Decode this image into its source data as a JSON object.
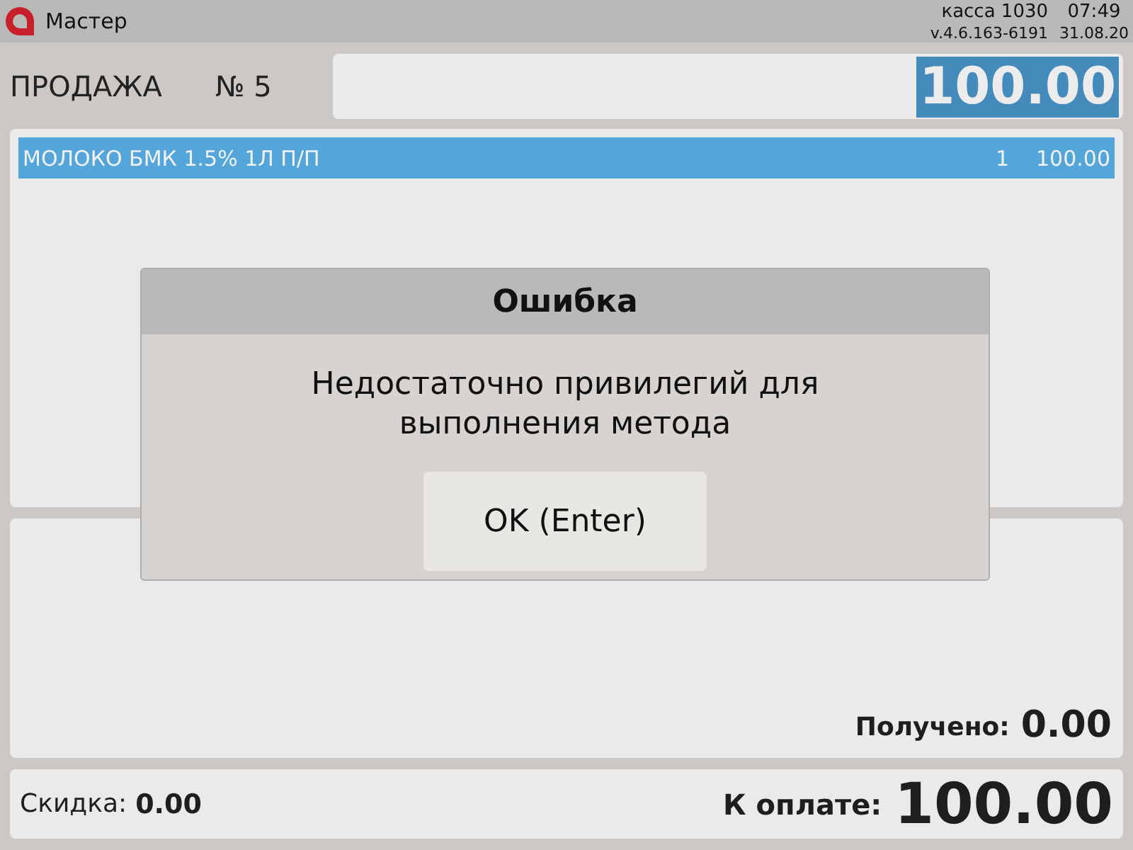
{
  "top_bar": {
    "app_name": "Мастер",
    "register": "касса 1030",
    "time": "07:49",
    "version": "v.4.6.163-6191",
    "date": "31.08.20"
  },
  "header": {
    "title": "ПРОДАЖА",
    "number": "№ 5",
    "total_field": {
      "value": "100.00",
      "highlighted": true
    }
  },
  "receipt": {
    "rows": [
      {
        "name": "МОЛОКО БМК 1.5% 1Л П/П",
        "quantity": "1",
        "amount": "100.00",
        "selected": true
      }
    ]
  },
  "payment": {
    "received_label": "Получено:",
    "received_value": "0.00"
  },
  "footer": {
    "discount_label": "Скидка:",
    "discount_value": "0.00",
    "due_label": "К оплате:",
    "due_value": "100.00"
  },
  "dialog": {
    "title": "Ошибка",
    "message": "Недостаточно привилегий для выполнения метода",
    "buttons": [
      "OK (Enter)"
    ]
  }
}
